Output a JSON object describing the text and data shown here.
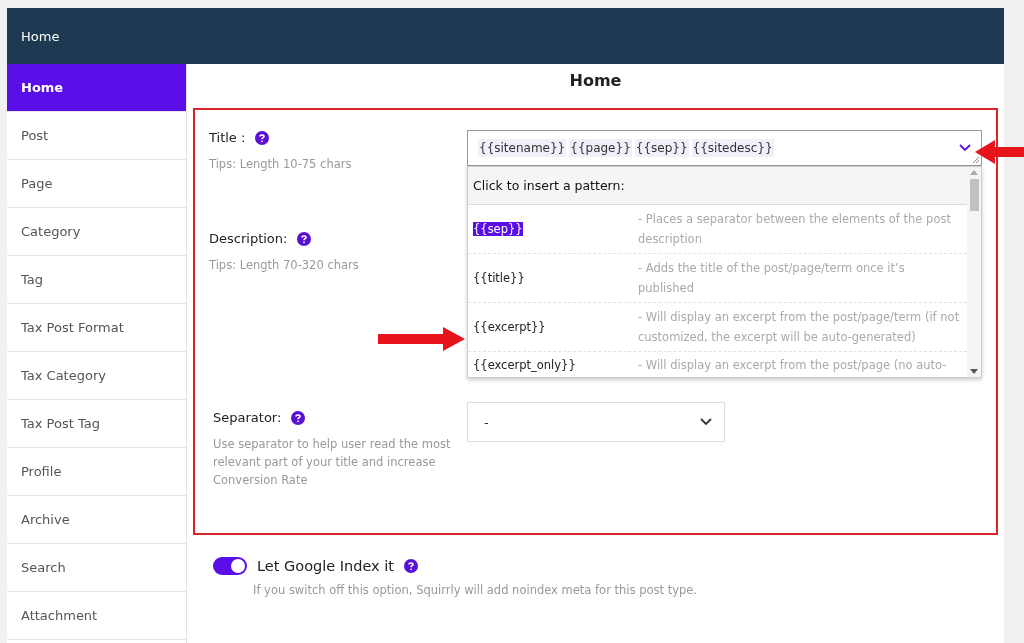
{
  "header": {
    "title": "Home"
  },
  "sidebar": {
    "items": [
      {
        "label": "Home",
        "selected": true
      },
      {
        "label": "Post",
        "selected": false
      },
      {
        "label": "Page",
        "selected": false
      },
      {
        "label": "Category",
        "selected": false
      },
      {
        "label": "Tag",
        "selected": false
      },
      {
        "label": "Tax Post Format",
        "selected": false
      },
      {
        "label": "Tax Category",
        "selected": false
      },
      {
        "label": "Tax Post Tag",
        "selected": false
      },
      {
        "label": "Profile",
        "selected": false
      },
      {
        "label": "Archive",
        "selected": false
      },
      {
        "label": "Search",
        "selected": false
      },
      {
        "label": "Attachment",
        "selected": false
      }
    ]
  },
  "page_title": "Home",
  "title_field": {
    "label": "Title :",
    "tip": "Tips: Length 10-75 chars",
    "tokens": [
      "{{sitename}}",
      "{{page}}",
      "{{sep}}",
      "{{sitedesc}}"
    ]
  },
  "pattern_menu": {
    "heading": "Click to insert a pattern:",
    "items": [
      {
        "token": "{{sep}}",
        "description": "- Places a separator between the elements of the post description",
        "selected": true
      },
      {
        "token": "{{title}}",
        "description": "- Adds the title of the post/page/term once it’s published",
        "selected": false
      },
      {
        "token": "{{excerpt}}",
        "description": "- Will display an excerpt from the post/page/term (if not customized, the excerpt will be auto-generated)",
        "selected": false
      },
      {
        "token": "{{excerpt_only}}",
        "description": "- Will display an excerpt from the post/page (no auto-",
        "selected": false
      }
    ]
  },
  "description_field": {
    "label": "Description:",
    "tip": "Tips: Length 70-320 chars"
  },
  "separator_field": {
    "label": "Separator:",
    "tip": "Use separator to help user read the most relevant part of your title and increase Conversion Rate",
    "value": "-"
  },
  "index_toggle": {
    "label": "Let Google Index it",
    "on": true,
    "hint": "If you switch off this option, Squirrly will add noindex meta for this post type."
  }
}
